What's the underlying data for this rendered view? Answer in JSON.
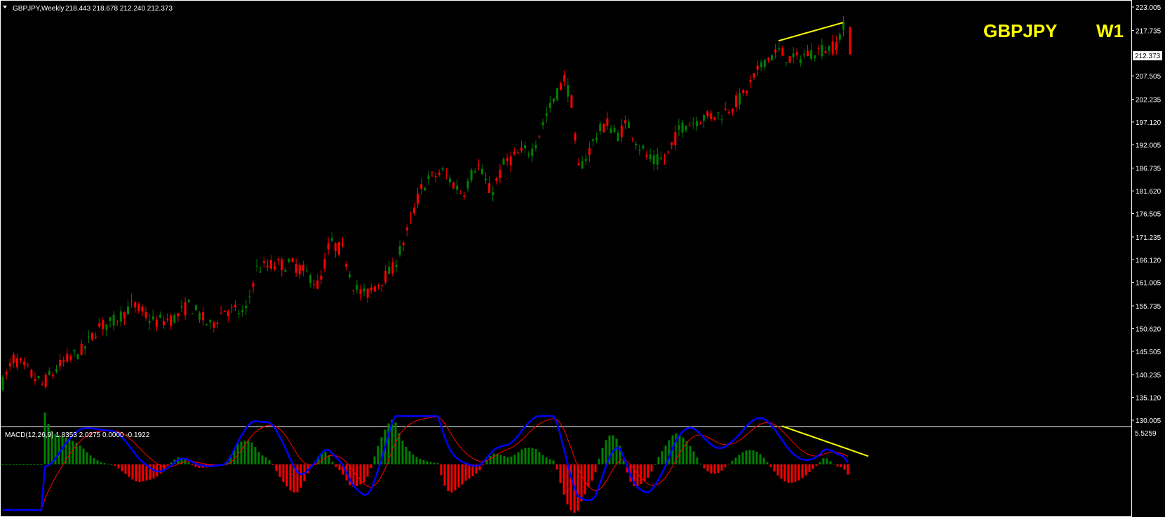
{
  "header": {
    "title": "GBPJPY,Weekly",
    "ohlc": "218.443 218.678 212.240 212.373",
    "symbol_label": "GBPJPY",
    "timeframe_label": "W1"
  },
  "price_axis": {
    "labels": [
      "223.005",
      "217.735",
      "207.505",
      "202.235",
      "197.120",
      "192.005",
      "186.735",
      "181.620",
      "176.505",
      "171.235",
      "166.120",
      "161.005",
      "155.735",
      "150.620",
      "145.505",
      "140.235",
      "135.120",
      "130.005"
    ],
    "current_price": "212.373"
  },
  "macd": {
    "title": "MACD(12,26,9) 1.8353 2.0275 0.0000 -0.1922",
    "axis_top": "5.5259"
  },
  "colors": {
    "background": "#000000",
    "bull": "#008000",
    "bear": "#ff0000",
    "histogram_pos": "#008000",
    "histogram_neg": "#ff0000",
    "macd_line": "#0000ff",
    "signal_line": "#ff0000",
    "trendline": "#ffff00",
    "text": "#ffffff",
    "label": "#ffff00"
  },
  "chart_data": {
    "type": "candlestick",
    "symbol": "GBPJPY",
    "timeframe": "Weekly",
    "ylim": [
      130.005,
      223.005
    ],
    "path": [
      [
        0,
        137
      ],
      [
        20,
        144
      ],
      [
        40,
        141
      ],
      [
        60,
        138
      ],
      [
        90,
        143
      ],
      [
        120,
        146
      ],
      [
        140,
        151
      ],
      [
        160,
        152
      ],
      [
        190,
        156
      ],
      [
        220,
        152
      ],
      [
        250,
        153
      ],
      [
        270,
        156
      ],
      [
        300,
        151
      ],
      [
        320,
        155
      ],
      [
        350,
        154
      ],
      [
        365,
        164
      ],
      [
        390,
        165
      ],
      [
        420,
        165
      ],
      [
        445,
        162
      ],
      [
        455,
        160
      ],
      [
        470,
        170
      ],
      [
        490,
        168
      ],
      [
        505,
        160
      ],
      [
        520,
        158
      ],
      [
        540,
        161
      ],
      [
        560,
        164
      ],
      [
        580,
        172
      ],
      [
        600,
        182
      ],
      [
        610,
        184
      ],
      [
        630,
        186
      ],
      [
        660,
        181
      ],
      [
        680,
        188
      ],
      [
        700,
        181
      ],
      [
        720,
        188
      ],
      [
        740,
        190
      ],
      [
        760,
        191
      ],
      [
        780,
        199
      ],
      [
        805,
        207
      ],
      [
        818,
        200
      ],
      [
        822,
        186
      ],
      [
        835,
        189
      ],
      [
        850,
        194
      ],
      [
        865,
        197
      ],
      [
        880,
        194
      ],
      [
        895,
        197
      ],
      [
        910,
        192
      ],
      [
        930,
        188
      ],
      [
        950,
        189
      ],
      [
        970,
        196
      ],
      [
        1000,
        198
      ],
      [
        1030,
        199
      ],
      [
        1060,
        203
      ],
      [
        1090,
        211
      ],
      [
        1110,
        213
      ],
      [
        1130,
        211
      ],
      [
        1160,
        213
      ],
      [
        1190,
        214
      ],
      [
        1205,
        219
      ],
      [
        1212,
        212.37
      ]
    ],
    "last": {
      "open": 218.443,
      "high": 218.678,
      "low": 212.24,
      "close": 212.373
    },
    "trendline_price": {
      "from": [
        1110,
        215.4
      ],
      "to": [
        1202,
        219.5
      ]
    },
    "macd": {
      "params": "12,26,9",
      "main": 1.8353,
      "signal": 2.0275,
      "histogram": -0.1922,
      "ylim": [
        -5.5,
        5.5259
      ],
      "trendline": {
        "from": [
          1115,
          4.2
        ],
        "to": [
          1238,
          0.9
        ]
      }
    }
  }
}
